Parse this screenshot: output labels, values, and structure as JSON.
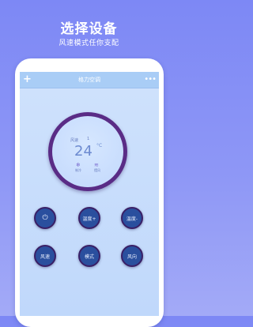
{
  "promo": {
    "title": "选择设备",
    "subtitle": "风速模式任你支配"
  },
  "app": {
    "add_icon": "+",
    "title": "格力空调",
    "more_icon": "•••"
  },
  "dial": {
    "wind_label": "风速",
    "wind_value": "1",
    "temperature": "24",
    "unit": "°C",
    "mode_icon": "❄",
    "mode_label": "制冷",
    "swing_icon": "≋",
    "swing_label": "摆风"
  },
  "buttons": {
    "power_icon": "⏻",
    "temp_up": "温度+",
    "temp_down": "温度-",
    "wind_speed": "风速",
    "mode": "模式",
    "swing": "风向"
  },
  "colors": {
    "background": "#7d88f5",
    "dial_ring": "#5a2c86",
    "button": "#2a4f9e"
  }
}
